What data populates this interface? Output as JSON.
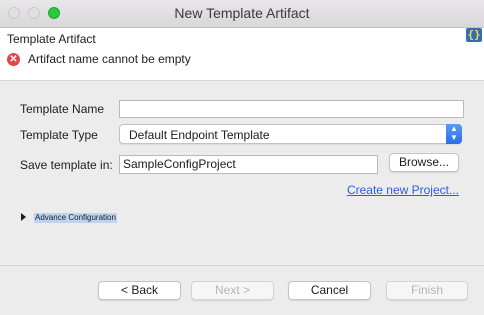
{
  "window": {
    "title": "New Template Artifact"
  },
  "header": {
    "title": "Template Artifact",
    "error_message": "Artifact name cannot be empty",
    "icon": "code-braces-icon"
  },
  "form": {
    "template_name": {
      "label": "Template Name",
      "value": ""
    },
    "template_type": {
      "label": "Template Type",
      "value": "Default Endpoint Template"
    },
    "save_in": {
      "label": "Save template in:",
      "value": "SampleConfigProject",
      "browse_label": "Browse..."
    },
    "create_project_link": "Create new Project...",
    "advance_label": "Advance Configuration"
  },
  "footer": {
    "back": "< Back",
    "next": "Next >",
    "cancel": "Cancel",
    "finish": "Finish"
  },
  "colors": {
    "link": "#2b5fd6",
    "error": "#e0454a",
    "accent": "#2a6ee8"
  }
}
